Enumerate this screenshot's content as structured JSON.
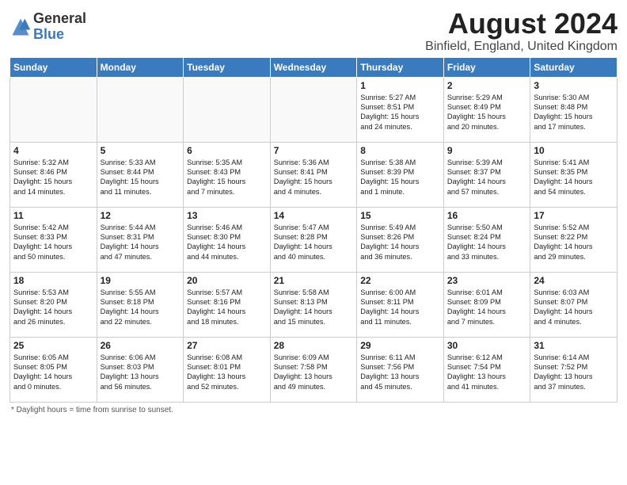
{
  "header": {
    "logo_general": "General",
    "logo_blue": "Blue",
    "title": "August 2024",
    "subtitle": "Binfield, England, United Kingdom"
  },
  "columns": [
    "Sunday",
    "Monday",
    "Tuesday",
    "Wednesday",
    "Thursday",
    "Friday",
    "Saturday"
  ],
  "weeks": [
    [
      {
        "day": "",
        "info": ""
      },
      {
        "day": "",
        "info": ""
      },
      {
        "day": "",
        "info": ""
      },
      {
        "day": "",
        "info": ""
      },
      {
        "day": "1",
        "info": "Sunrise: 5:27 AM\nSunset: 8:51 PM\nDaylight: 15 hours\nand 24 minutes."
      },
      {
        "day": "2",
        "info": "Sunrise: 5:29 AM\nSunset: 8:49 PM\nDaylight: 15 hours\nand 20 minutes."
      },
      {
        "day": "3",
        "info": "Sunrise: 5:30 AM\nSunset: 8:48 PM\nDaylight: 15 hours\nand 17 minutes."
      }
    ],
    [
      {
        "day": "4",
        "info": "Sunrise: 5:32 AM\nSunset: 8:46 PM\nDaylight: 15 hours\nand 14 minutes."
      },
      {
        "day": "5",
        "info": "Sunrise: 5:33 AM\nSunset: 8:44 PM\nDaylight: 15 hours\nand 11 minutes."
      },
      {
        "day": "6",
        "info": "Sunrise: 5:35 AM\nSunset: 8:43 PM\nDaylight: 15 hours\nand 7 minutes."
      },
      {
        "day": "7",
        "info": "Sunrise: 5:36 AM\nSunset: 8:41 PM\nDaylight: 15 hours\nand 4 minutes."
      },
      {
        "day": "8",
        "info": "Sunrise: 5:38 AM\nSunset: 8:39 PM\nDaylight: 15 hours\nand 1 minute."
      },
      {
        "day": "9",
        "info": "Sunrise: 5:39 AM\nSunset: 8:37 PM\nDaylight: 14 hours\nand 57 minutes."
      },
      {
        "day": "10",
        "info": "Sunrise: 5:41 AM\nSunset: 8:35 PM\nDaylight: 14 hours\nand 54 minutes."
      }
    ],
    [
      {
        "day": "11",
        "info": "Sunrise: 5:42 AM\nSunset: 8:33 PM\nDaylight: 14 hours\nand 50 minutes."
      },
      {
        "day": "12",
        "info": "Sunrise: 5:44 AM\nSunset: 8:31 PM\nDaylight: 14 hours\nand 47 minutes."
      },
      {
        "day": "13",
        "info": "Sunrise: 5:46 AM\nSunset: 8:30 PM\nDaylight: 14 hours\nand 44 minutes."
      },
      {
        "day": "14",
        "info": "Sunrise: 5:47 AM\nSunset: 8:28 PM\nDaylight: 14 hours\nand 40 minutes."
      },
      {
        "day": "15",
        "info": "Sunrise: 5:49 AM\nSunset: 8:26 PM\nDaylight: 14 hours\nand 36 minutes."
      },
      {
        "day": "16",
        "info": "Sunrise: 5:50 AM\nSunset: 8:24 PM\nDaylight: 14 hours\nand 33 minutes."
      },
      {
        "day": "17",
        "info": "Sunrise: 5:52 AM\nSunset: 8:22 PM\nDaylight: 14 hours\nand 29 minutes."
      }
    ],
    [
      {
        "day": "18",
        "info": "Sunrise: 5:53 AM\nSunset: 8:20 PM\nDaylight: 14 hours\nand 26 minutes."
      },
      {
        "day": "19",
        "info": "Sunrise: 5:55 AM\nSunset: 8:18 PM\nDaylight: 14 hours\nand 22 minutes."
      },
      {
        "day": "20",
        "info": "Sunrise: 5:57 AM\nSunset: 8:16 PM\nDaylight: 14 hours\nand 18 minutes."
      },
      {
        "day": "21",
        "info": "Sunrise: 5:58 AM\nSunset: 8:13 PM\nDaylight: 14 hours\nand 15 minutes."
      },
      {
        "day": "22",
        "info": "Sunrise: 6:00 AM\nSunset: 8:11 PM\nDaylight: 14 hours\nand 11 minutes."
      },
      {
        "day": "23",
        "info": "Sunrise: 6:01 AM\nSunset: 8:09 PM\nDaylight: 14 hours\nand 7 minutes."
      },
      {
        "day": "24",
        "info": "Sunrise: 6:03 AM\nSunset: 8:07 PM\nDaylight: 14 hours\nand 4 minutes."
      }
    ],
    [
      {
        "day": "25",
        "info": "Sunrise: 6:05 AM\nSunset: 8:05 PM\nDaylight: 14 hours\nand 0 minutes."
      },
      {
        "day": "26",
        "info": "Sunrise: 6:06 AM\nSunset: 8:03 PM\nDaylight: 13 hours\nand 56 minutes."
      },
      {
        "day": "27",
        "info": "Sunrise: 6:08 AM\nSunset: 8:01 PM\nDaylight: 13 hours\nand 52 minutes."
      },
      {
        "day": "28",
        "info": "Sunrise: 6:09 AM\nSunset: 7:58 PM\nDaylight: 13 hours\nand 49 minutes."
      },
      {
        "day": "29",
        "info": "Sunrise: 6:11 AM\nSunset: 7:56 PM\nDaylight: 13 hours\nand 45 minutes."
      },
      {
        "day": "30",
        "info": "Sunrise: 6:12 AM\nSunset: 7:54 PM\nDaylight: 13 hours\nand 41 minutes."
      },
      {
        "day": "31",
        "info": "Sunrise: 6:14 AM\nSunset: 7:52 PM\nDaylight: 13 hours\nand 37 minutes."
      }
    ]
  ],
  "footer": "Daylight hours"
}
